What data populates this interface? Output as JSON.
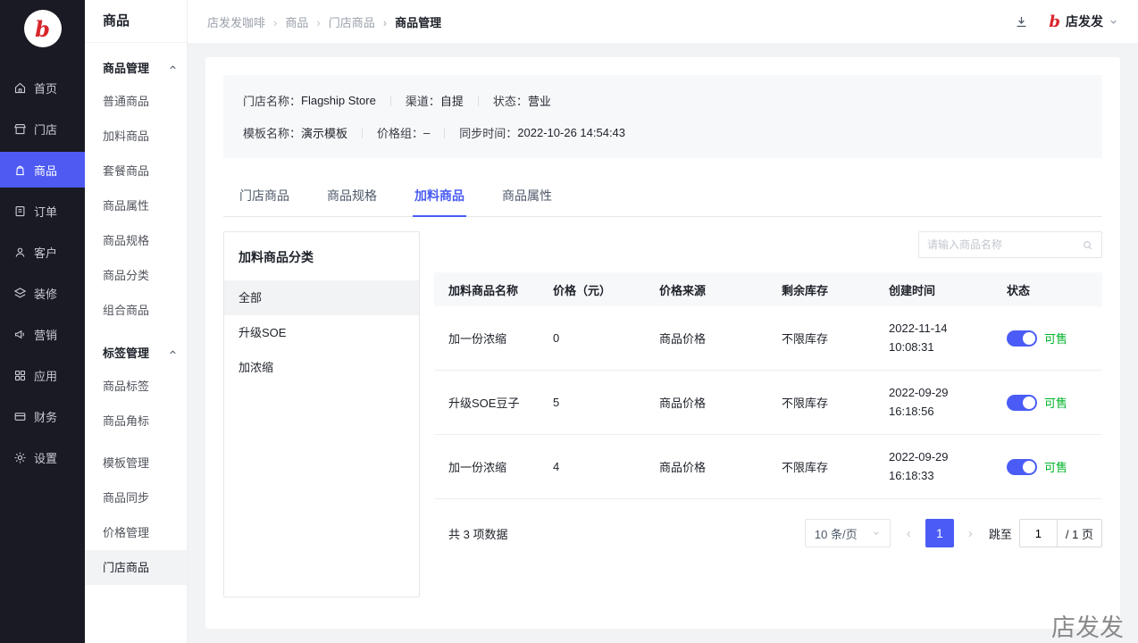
{
  "brand": {
    "logo_letter": "b",
    "watermark": "店发发"
  },
  "colors": {
    "accent": "#4a5cf5",
    "nav_active": "#4e5af2",
    "success": "#00b42a",
    "sidebar_bg": "#191a23",
    "logo_red": "#d8262c"
  },
  "nav": {
    "items": [
      {
        "label": "首页",
        "icon": "home-icon"
      },
      {
        "label": "门店",
        "icon": "store-icon"
      },
      {
        "label": "商品",
        "icon": "product-icon"
      },
      {
        "label": "订单",
        "icon": "order-icon"
      },
      {
        "label": "客户",
        "icon": "customer-icon"
      },
      {
        "label": "装修",
        "icon": "decorate-icon"
      },
      {
        "label": "营销",
        "icon": "marketing-icon"
      },
      {
        "label": "应用",
        "icon": "apps-icon"
      },
      {
        "label": "财务",
        "icon": "finance-icon"
      },
      {
        "label": "设置",
        "icon": "settings-icon"
      }
    ],
    "active": "商品"
  },
  "submenu": {
    "title": "商品",
    "group1": {
      "label": "商品管理",
      "items": [
        "普通商品",
        "加料商品",
        "套餐商品",
        "商品属性",
        "商品规格",
        "商品分类",
        "组合商品"
      ]
    },
    "group2": {
      "label": "标签管理",
      "items": [
        "商品标签",
        "商品角标"
      ]
    },
    "loose_items": [
      "模板管理",
      "商品同步",
      "价格管理",
      "门店商品"
    ],
    "active_item": "门店商品"
  },
  "header": {
    "breadcrumb": [
      "店发发咖啡",
      "商品",
      "门店商品",
      "商品管理"
    ],
    "account_name": "店发发"
  },
  "info_panel": {
    "row1": [
      {
        "label": "门店名称：",
        "value": "Flagship Store"
      },
      {
        "label": "渠道：",
        "value": "自提"
      },
      {
        "label": "状态：",
        "value": "营业"
      }
    ],
    "row2": [
      {
        "label": "模板名称：",
        "value": "演示模板"
      },
      {
        "label": "价格组：",
        "value": "–"
      },
      {
        "label": "同步时间：",
        "value": "2022-10-26 14:54:43"
      }
    ]
  },
  "tabs": [
    "门店商品",
    "商品规格",
    "加料商品",
    "商品属性"
  ],
  "active_tab": "加料商品",
  "category_panel": {
    "title": "加料商品分类",
    "items": [
      "全部",
      "升级SOE",
      "加浓缩"
    ],
    "active_item": "全部"
  },
  "search": {
    "placeholder": "请输入商品名称"
  },
  "table": {
    "columns": [
      "加料商品名称",
      "价格（元）",
      "价格来源",
      "剩余库存",
      "创建时间",
      "状态"
    ],
    "rows": [
      {
        "name": "加一份浓缩",
        "price": "0",
        "source": "商品价格",
        "stock": "不限库存",
        "date": "2022-11-14",
        "time": "10:08:31",
        "status": "可售",
        "toggle_on": true
      },
      {
        "name": "升级SOE豆子",
        "price": "5",
        "source": "商品价格",
        "stock": "不限库存",
        "date": "2022-09-29",
        "time": "16:18:56",
        "status": "可售",
        "toggle_on": true
      },
      {
        "name": "加一份浓缩",
        "price": "4",
        "source": "商品价格",
        "stock": "不限库存",
        "date": "2022-09-29",
        "time": "16:18:33",
        "status": "可售",
        "toggle_on": true
      }
    ]
  },
  "pagination": {
    "total_text": "共 3 项数据",
    "page_size": "10 条/页",
    "current_page": "1",
    "jump_label": "跳至",
    "jump_value": "1",
    "total_pages_text": "/ 1 页"
  }
}
